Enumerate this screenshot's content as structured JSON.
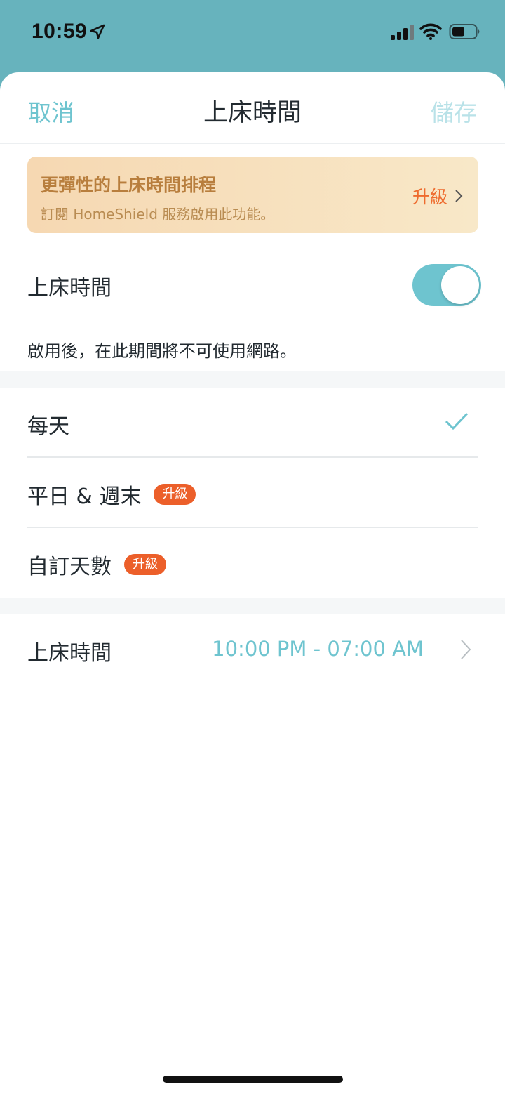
{
  "status_bar": {
    "time": "10:59",
    "icons": [
      "location-arrow-icon",
      "cellular-signal-icon",
      "wifi-icon",
      "battery-icon"
    ]
  },
  "nav": {
    "cancel_label": "取消",
    "title": "上床時間",
    "save_label": "儲存"
  },
  "promo": {
    "title": "更彈性的上床時間排程",
    "subtitle": "訂閱 HomeShield 服務啟用此功能。",
    "action_label": "升級"
  },
  "bedtime_toggle": {
    "label": "上床時間",
    "enabled": true,
    "description": "啟用後，在此期間將不可使用網路。"
  },
  "schedule_options": [
    {
      "label": "每天",
      "selected": true,
      "badge": ""
    },
    {
      "label": "平日 & 週末",
      "selected": false,
      "badge": "升級"
    },
    {
      "label": "自訂天數",
      "selected": false,
      "badge": "升級"
    }
  ],
  "time_row": {
    "label": "上床時間",
    "value": "10:00 PM - 07:00 AM"
  },
  "colors": {
    "accent": "#6ec4cf",
    "header_bg": "#67b3bd",
    "badge": "#ec5f2a",
    "promo_title": "#b87e3d",
    "upgrade_link": "#ee6b2e"
  }
}
